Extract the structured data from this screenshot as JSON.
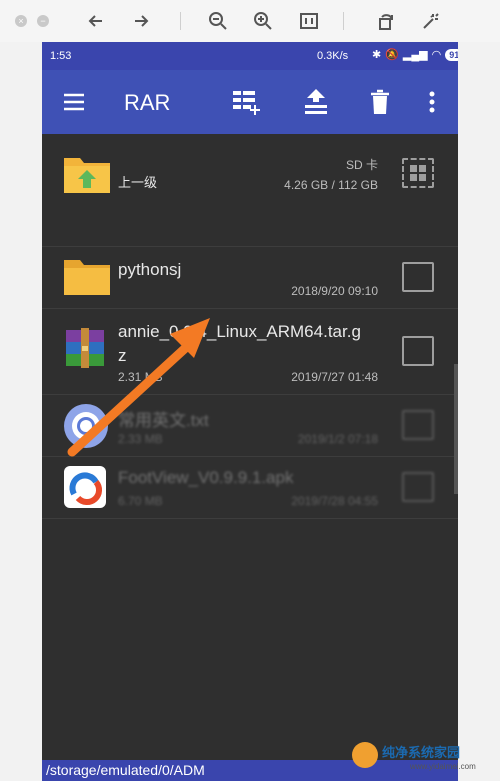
{
  "viewer": {
    "icons": [
      "close-dot-icon",
      "minimize-dot-icon",
      "back-arrow-icon",
      "forward-arrow-icon",
      "zoom-out-icon",
      "zoom-in-icon",
      "fit-icon",
      "rotate-icon",
      "magic-icon"
    ]
  },
  "status": {
    "time": "1:53",
    "net_speed": "0.3K/s",
    "battery": "91"
  },
  "appbar": {
    "title": "RAR"
  },
  "rows": [
    {
      "name": "上一级",
      "right_top": "SD 卡",
      "right_bottom": "4.26 GB / 112 GB"
    },
    {
      "name": "pythonsj",
      "date": "2018/9/20 09:10"
    },
    {
      "name_line1": "annie_0.9.4_Linux_ARM64.tar.g",
      "name_line2": "z",
      "size": "2.31 MB",
      "date": "2019/7/27 01:48"
    },
    {
      "name": "常用英文.txt",
      "size": "2.33 MB",
      "date": "2019/1/2 07:18"
    },
    {
      "name": "FootView_V0.9.9.1.apk",
      "size": "6.70 MB",
      "date": "2019/7/28 04:55"
    }
  ],
  "footer": {
    "path": "/storage/emulated/0/ADM"
  },
  "watermark": {
    "site": "纯净系统家园",
    "url": "www.yidaimei.com"
  }
}
